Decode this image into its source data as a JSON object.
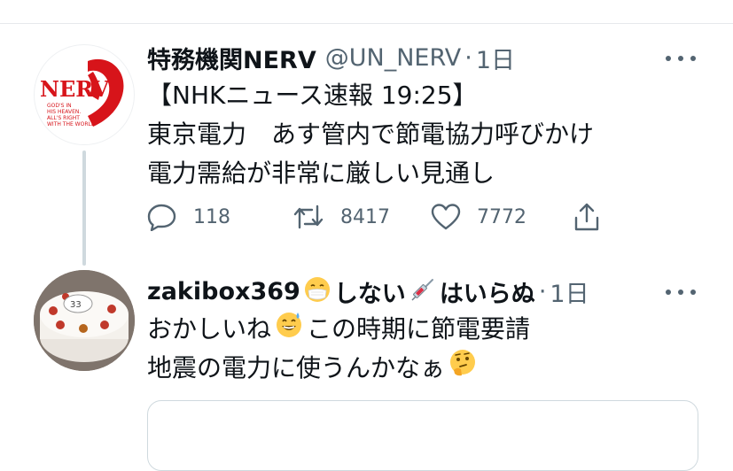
{
  "tweet": {
    "display_name": "特務機関NERV",
    "handle": "@UN_NERV",
    "separator": "·",
    "time": "1日",
    "lines": [
      "【NHKニュース速報 19:25】",
      "東京電力　あす管内で節電協力呼びかけ",
      "電力需給が非常に厳しい見通し"
    ],
    "reply_count": "118",
    "retweet_count": "8417",
    "like_count": "7772",
    "avatar_logo": "NERV",
    "avatar_motto": [
      "GOD'S IN",
      "HIS HEAVEN.",
      "ALL'S RIGHT",
      "WITH THE WORLD"
    ]
  },
  "reply": {
    "display_name_part1": "zakibox369",
    "display_name_part2": "しない",
    "display_name_part3": "はいらぬ",
    "separator": "·",
    "time": "1日",
    "line1_part1": "おかしいね",
    "line1_part2": "この時期に節電要請",
    "line2": "地震の電力に使うんかなぁ",
    "avatar_cake_label": "33",
    "emoji": [
      "mask-face-emoji",
      "syringe-emoji",
      "sweat-smile-emoji",
      "thinking-face-emoji"
    ]
  },
  "icons": [
    "reply-icon",
    "retweet-icon",
    "like-icon",
    "share-icon",
    "more-icon"
  ],
  "colors": {
    "text": "#0f1419",
    "secondary": "#536471",
    "nerv_red": "#d7141a",
    "divider": "#cfd9de"
  }
}
